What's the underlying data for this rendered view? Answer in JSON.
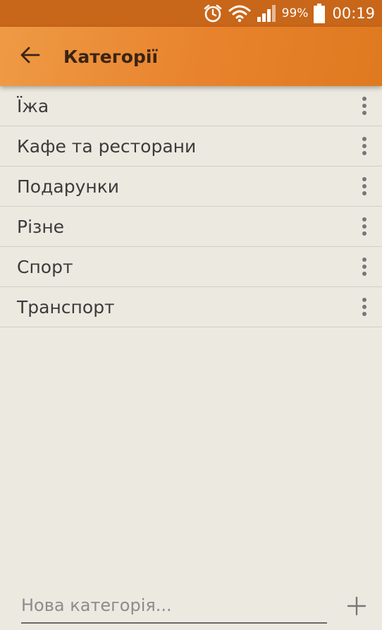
{
  "status_bar": {
    "icons": [
      "alarm-icon",
      "wifi-icon",
      "signal-icon",
      "battery-icon"
    ],
    "battery_percent": "99%",
    "time": "00:19"
  },
  "app_bar": {
    "title": "Категорії",
    "back_icon": "arrow-left-icon"
  },
  "categories": [
    {
      "label": "Їжа"
    },
    {
      "label": "Кафе та ресторани"
    },
    {
      "label": "Подарунки"
    },
    {
      "label": "Різне"
    },
    {
      "label": "Спорт"
    },
    {
      "label": "Транспорт"
    }
  ],
  "new_category": {
    "value": "",
    "placeholder": "Нова категорія..."
  },
  "colors": {
    "app_bar": "#e8822c",
    "status_bar": "#c8661a",
    "background": "#ece9e0",
    "title_text": "#3a2414"
  }
}
